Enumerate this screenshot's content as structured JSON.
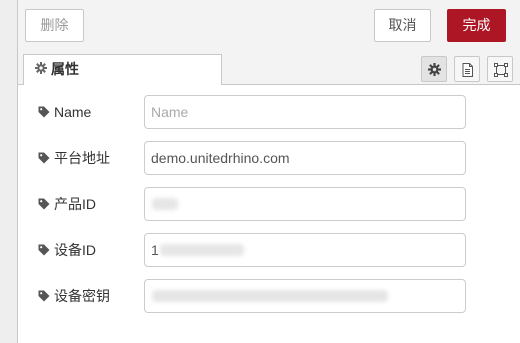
{
  "toolbar": {
    "delete_label": "删除",
    "cancel_label": "取消",
    "done_label": "完成"
  },
  "tabs": {
    "properties_label": "属性"
  },
  "fields": {
    "name": {
      "label": "Name",
      "value": "",
      "placeholder": "Name"
    },
    "platform_address": {
      "label": "平台地址",
      "value": "demo.unitedrhino.com",
      "placeholder": ""
    },
    "product_id": {
      "label": "产品ID",
      "value": "",
      "placeholder": ""
    },
    "device_id": {
      "label": "设备ID",
      "value": "1",
      "placeholder": ""
    },
    "device_secret": {
      "label": "设备密钥",
      "value": "",
      "placeholder": ""
    }
  },
  "colors": {
    "primary": "#ad1625",
    "panel_bg": "#f3f3f3",
    "border": "#c8c8c8"
  },
  "icons": [
    "gear-icon",
    "document-icon",
    "layout-icon",
    "tag-icon"
  ]
}
